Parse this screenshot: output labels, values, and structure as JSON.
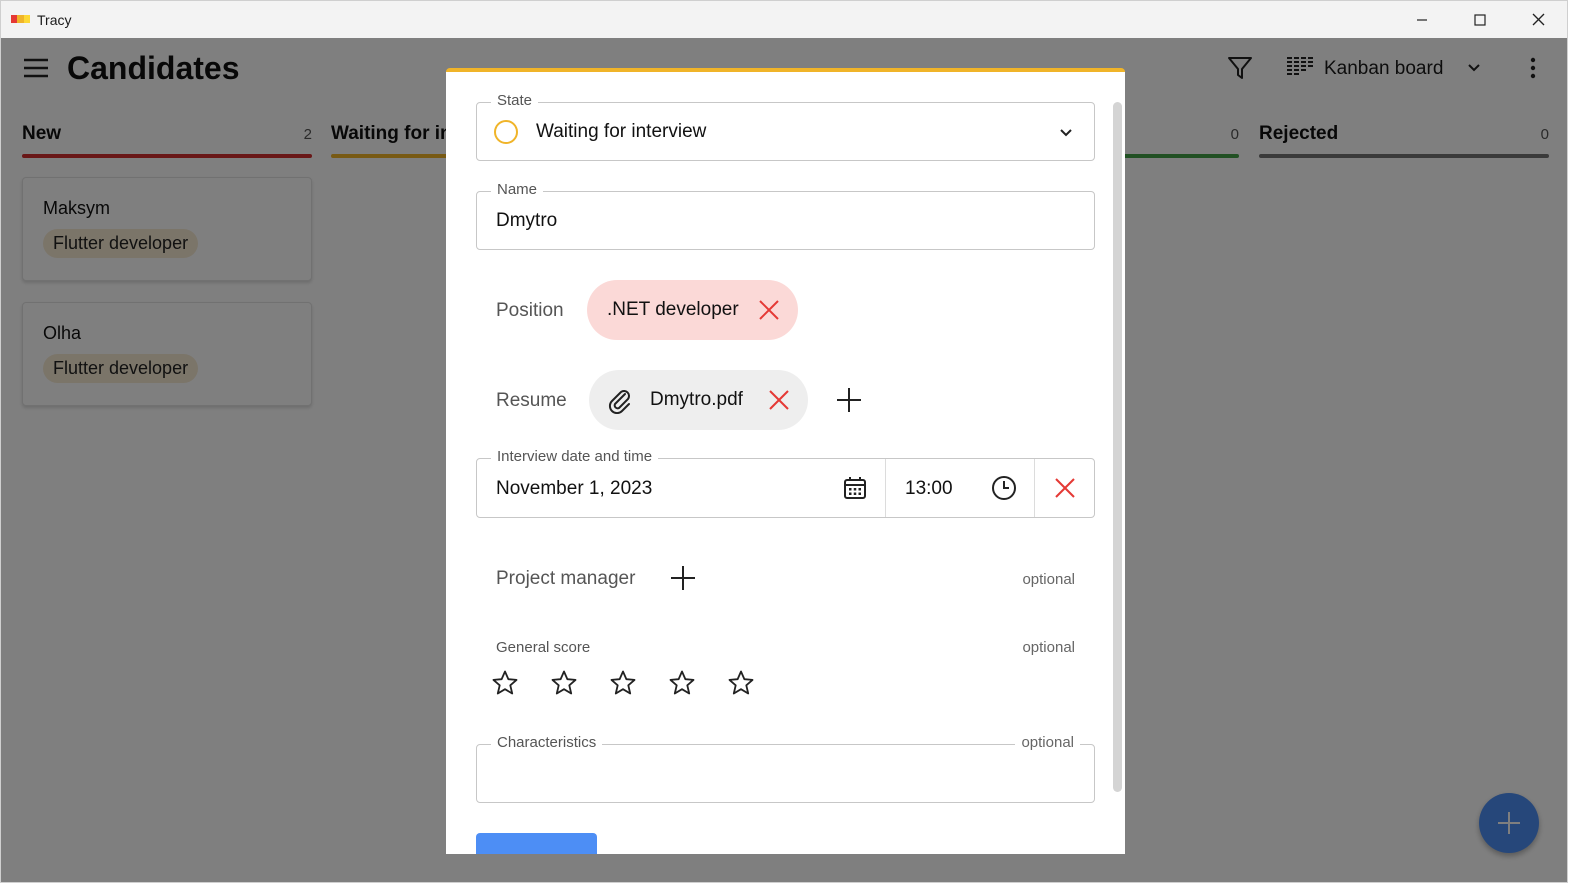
{
  "window": {
    "title": "Tracy",
    "logo_colors": [
      "#e53935",
      "#f0b429",
      "#fdd835"
    ]
  },
  "appbar": {
    "title": "Candidates",
    "view_label": "Kanban board"
  },
  "columns": [
    {
      "title": "New",
      "count": "2",
      "color": "#d32f2f"
    },
    {
      "title": "Waiting for interview",
      "count": "",
      "color": "#f0b429"
    },
    {
      "title": "",
      "count": "0",
      "color": "#43a047"
    },
    {
      "title": "Rejected",
      "count": "0",
      "color": "#757575"
    }
  ],
  "cards": [
    {
      "name": "Maksym",
      "position": "Flutter developer"
    },
    {
      "name": "Olha",
      "position": "Flutter developer"
    }
  ],
  "dialog": {
    "accent": "#f0b429",
    "state": {
      "label": "State",
      "value": "Waiting for interview"
    },
    "name": {
      "label": "Name",
      "value": "Dmytro"
    },
    "position": {
      "label": "Position",
      "chip": ".NET developer"
    },
    "resume": {
      "label": "Resume",
      "file": "Dmytro.pdf"
    },
    "interview": {
      "label": "Interview date and time",
      "date": "November 1, 2023",
      "time": "13:00"
    },
    "project_manager": {
      "label": "Project manager",
      "optional": "optional"
    },
    "general_score": {
      "label": "General score",
      "optional": "optional",
      "value": 0,
      "max": 5
    },
    "characteristics": {
      "label": "Characteristics",
      "optional": "optional",
      "value": ""
    }
  },
  "icons": {
    "menu": "menu-icon",
    "filter": "filter-icon",
    "kanban": "kanban-icon",
    "more": "more-vert-icon",
    "fab": "add-icon"
  }
}
